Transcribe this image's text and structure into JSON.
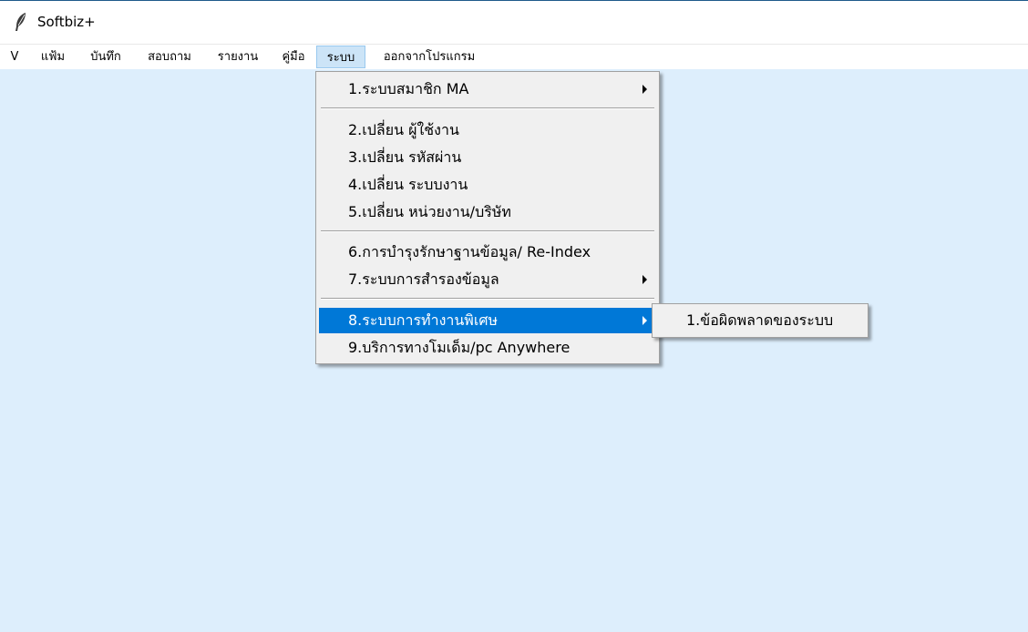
{
  "window": {
    "title": "Softbiz+",
    "icon": "feather-icon"
  },
  "menubar": {
    "items": [
      "V",
      "แฟ้ม",
      "บันทึก",
      "สอบถาม",
      "รายงาน",
      "คู่มือ",
      "ระบบ",
      "ออกจากโปรแกรม"
    ],
    "active": "ระบบ"
  },
  "dropdown": {
    "items": [
      "1.ระบบสมาชิก MA",
      "2.เปลี่ยน ผู้ใช้งาน",
      "3.เปลี่ยน รหัสผ่าน",
      "4.เปลี่ยน ระบบงาน",
      "5.เปลี่ยน หน่วยงาน/บริษัท",
      "6.การบำรุงรักษาฐานข้อมูล/ Re-Index",
      "7.ระบบการสำรองข้อมูล",
      "8.ระบบการทำงานพิเศษ",
      "9.บริการทางโมเด็ม/pc Anywhere"
    ],
    "highlighted": "8.ระบบการทำงานพิเศษ"
  },
  "submenu": {
    "items": [
      "1.ข้อผิดพลาดของระบบ"
    ]
  },
  "colors": {
    "workspace": "#ddeefc",
    "highlight": "#0078d7",
    "menu_bg": "#f0f0f0",
    "active_menubar": "#cce4f7"
  }
}
